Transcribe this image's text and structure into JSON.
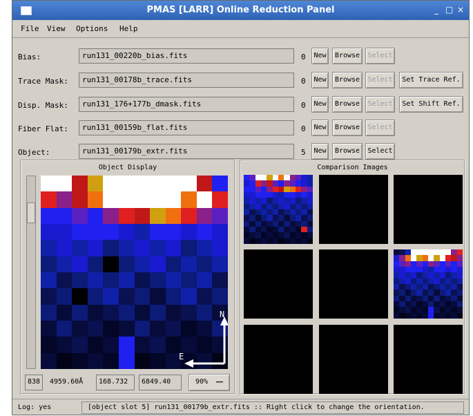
{
  "window": {
    "title": "PMAS [LARR] Online Reduction Panel",
    "controls": [
      "_",
      "□",
      "×"
    ]
  },
  "menu": [
    "File",
    "View",
    "Options",
    "Help"
  ],
  "rows": [
    {
      "label": "Bias:",
      "file": "run131_00220b_bias.fits",
      "count": "0",
      "new": "New",
      "browse": "Browse",
      "select": "Select",
      "select_enabled": false,
      "extra": ""
    },
    {
      "label": "Trace Mask:",
      "file": "run131_00178b_trace.fits",
      "count": "0",
      "new": "New",
      "browse": "Browse",
      "select": "Select",
      "select_enabled": false,
      "extra": "Set Trace Ref."
    },
    {
      "label": "Disp. Mask:",
      "file": "run131_176+177b_dmask.fits",
      "count": "0",
      "new": "New",
      "browse": "Browse",
      "select": "Select",
      "select_enabled": false,
      "extra": "Set Shift Ref."
    },
    {
      "label": "Fiber Flat:",
      "file": "run131_00159b_flat.fits",
      "count": "0",
      "new": "New",
      "browse": "Browse",
      "select": "Select",
      "select_enabled": false,
      "extra": ""
    },
    {
      "label": "Object:",
      "file": "run131_00179b_extr.fits",
      "count": "5",
      "new": "New",
      "browse": "Browse",
      "select": "Select",
      "select_enabled": true,
      "extra": ""
    }
  ],
  "object_display": {
    "title": "Object Display",
    "compass": {
      "north": "N",
      "east": "E"
    },
    "status": {
      "pixel": "838",
      "wavelength": "4959.60Å",
      "coord_x": "168.732",
      "coord_y": "6849.40",
      "zoom": "90%"
    }
  },
  "comparison": {
    "title": "Comparison Images"
  },
  "log": {
    "label": "Log: yes",
    "message": "[object slot 5] run131_00179b_extr.fits :: Right click to change the orientation."
  },
  "colors": {
    "title_bar": "#3d74c8",
    "window_bg": "#d4d0c8",
    "image_bg": "#000000"
  }
}
